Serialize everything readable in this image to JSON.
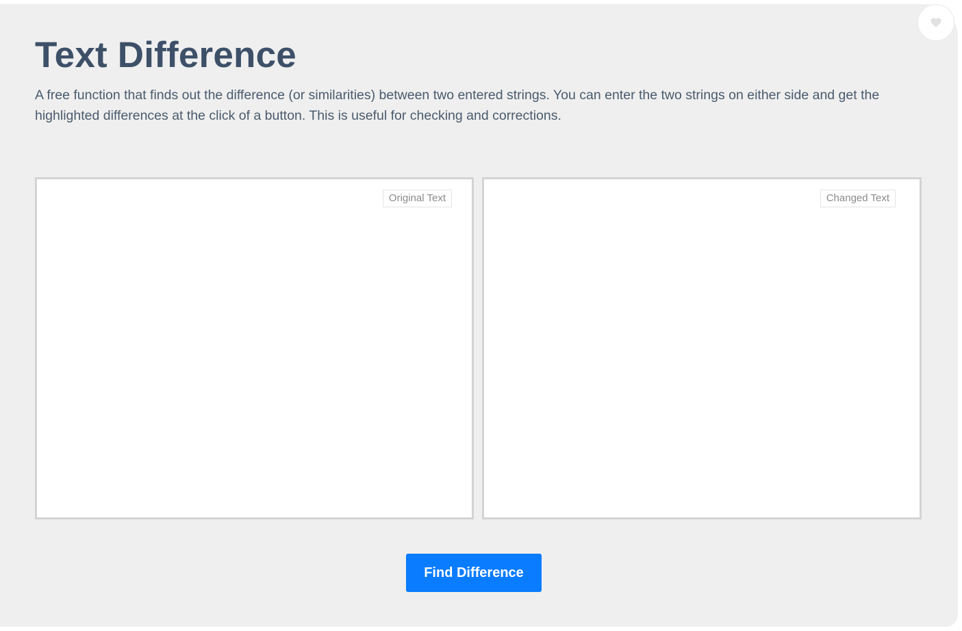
{
  "page": {
    "title": "Text Difference",
    "description": "A free function that finds out the difference (or similarities) between two entered strings. You can enter the two strings on either side and get the highlighted differences at the click of a button. This is useful for checking and corrections."
  },
  "inputs": {
    "original": {
      "label": "Original Text",
      "value": ""
    },
    "changed": {
      "label": "Changed Text",
      "value": ""
    }
  },
  "actions": {
    "find_label": "Find Difference"
  },
  "icons": {
    "favorite": "heart-icon"
  },
  "colors": {
    "background": "#efefef",
    "title": "#3d5068",
    "button": "#0a7cff",
    "panel_border": "#d3d3d3",
    "heart": "#e2e2e2"
  }
}
